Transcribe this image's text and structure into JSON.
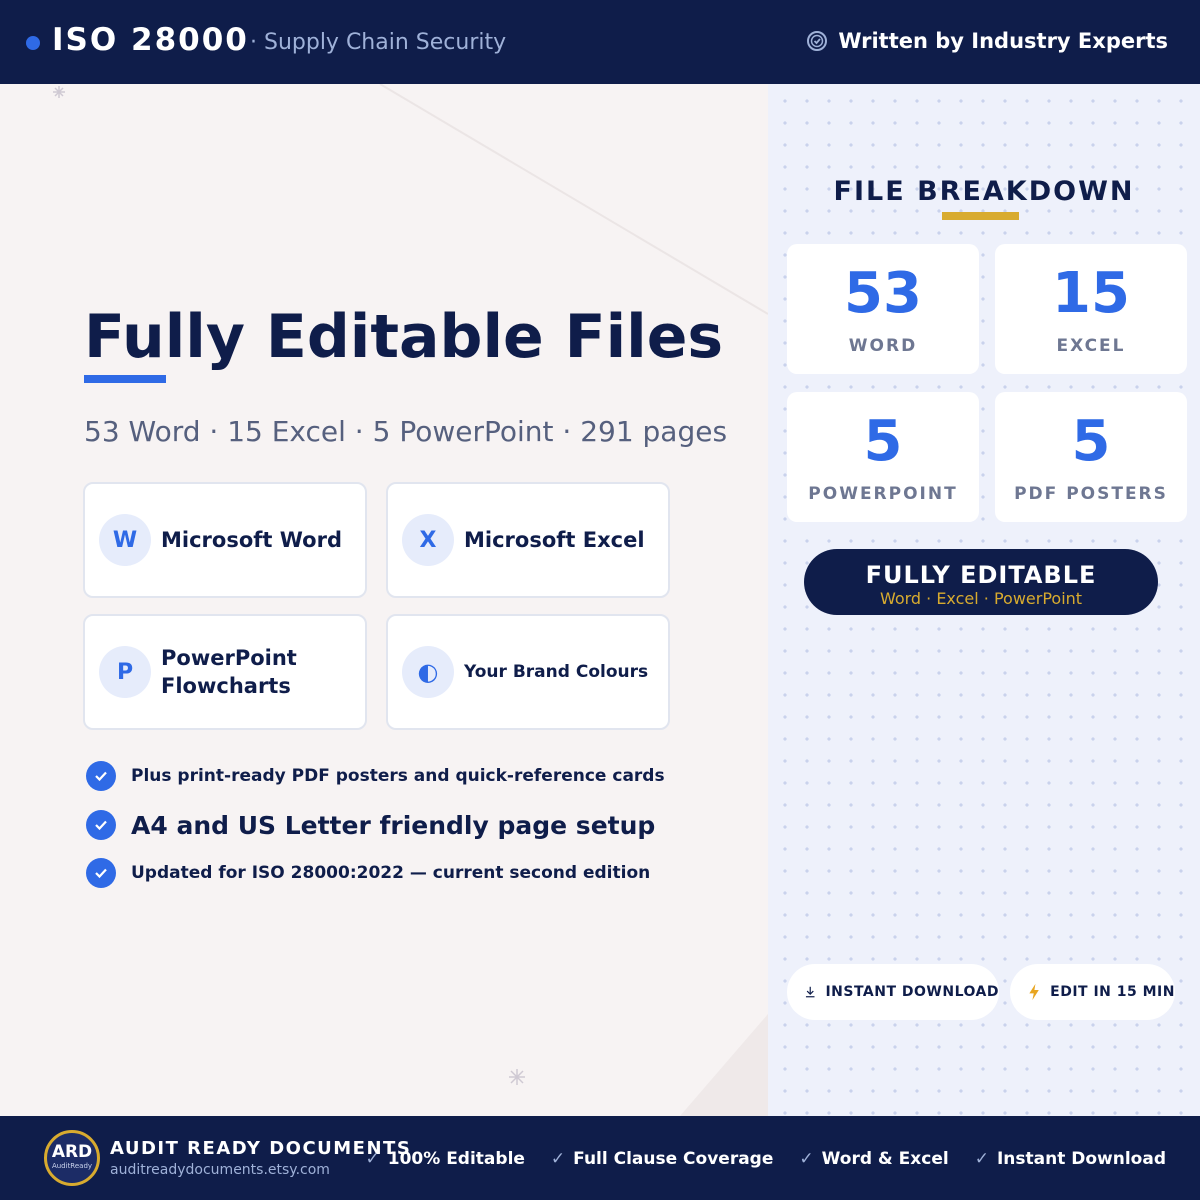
{
  "header": {
    "title": "ISO 28000",
    "subtitle": "· Supply Chain Security",
    "tagline": "Written by Industry Experts"
  },
  "main": {
    "title": "Fully Editable Files",
    "subtitle": "53 Word · 15 Excel · 5 PowerPoint · 291 pages",
    "features": [
      {
        "icon": "W",
        "label": "Microsoft Word"
      },
      {
        "icon": "X",
        "label": "Microsoft Excel"
      },
      {
        "icon": "P",
        "label": "PowerPoint Flowcharts"
      },
      {
        "icon": "◐",
        "label": "Your Brand Colours"
      }
    ],
    "checks": [
      "Plus print-ready PDF posters and quick-reference cards",
      "A4 and US Letter friendly page setup",
      "Updated for ISO 28000:2022 — current second edition"
    ]
  },
  "breakdown": {
    "title": "FILE BREAKDOWN",
    "stats": [
      {
        "value": "53",
        "label": "WORD"
      },
      {
        "value": "15",
        "label": "EXCEL"
      },
      {
        "value": "5",
        "label": "POWERPOINT"
      },
      {
        "value": "5",
        "label": "PDF POSTERS"
      }
    ],
    "pill_main": "FULLY EDITABLE",
    "pill_sub": "Word · Excel · PowerPoint",
    "badges": [
      {
        "icon": "download-icon",
        "label": "INSTANT DOWNLOAD"
      },
      {
        "icon": "lightning-icon",
        "label": "EDIT IN 15 MIN"
      }
    ]
  },
  "footer": {
    "logo_main": "ARD",
    "logo_sub": "AuditReady",
    "brand": "AUDIT READY DOCUMENTS",
    "url": "auditreadydocuments.etsy.com",
    "items": [
      "100% Editable",
      "Full Clause Coverage",
      "Word & Excel",
      "Instant Download"
    ]
  },
  "colors": {
    "navy": "#0f1d4a",
    "accent_blue": "#2f6ae6",
    "gold": "#d8ab2f"
  }
}
